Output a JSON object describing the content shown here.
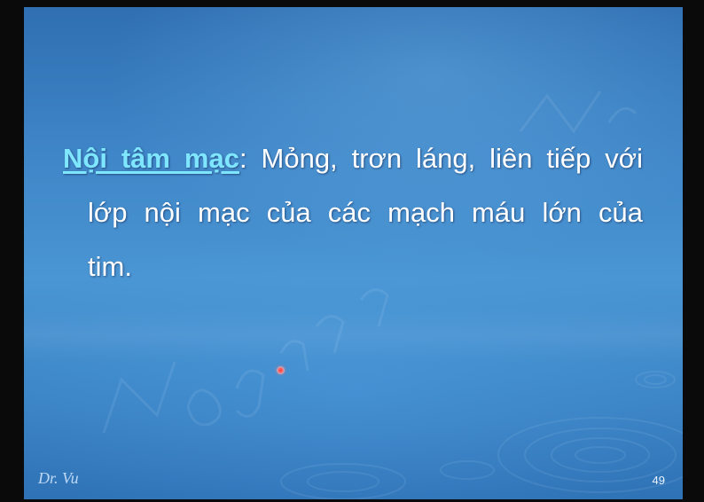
{
  "slide": {
    "term": "Nội tâm mạc",
    "line1_rest": ": Mỏng, trơn láng, liên tiếp với",
    "line2": "lớp nội mạc của các mạch máu lớn của",
    "line3": "tim.",
    "author": "Dr. Vu",
    "page_number": "49"
  },
  "colors": {
    "background": "#3f86c8",
    "term": "#7fe6ff",
    "text": "#ffffff"
  }
}
